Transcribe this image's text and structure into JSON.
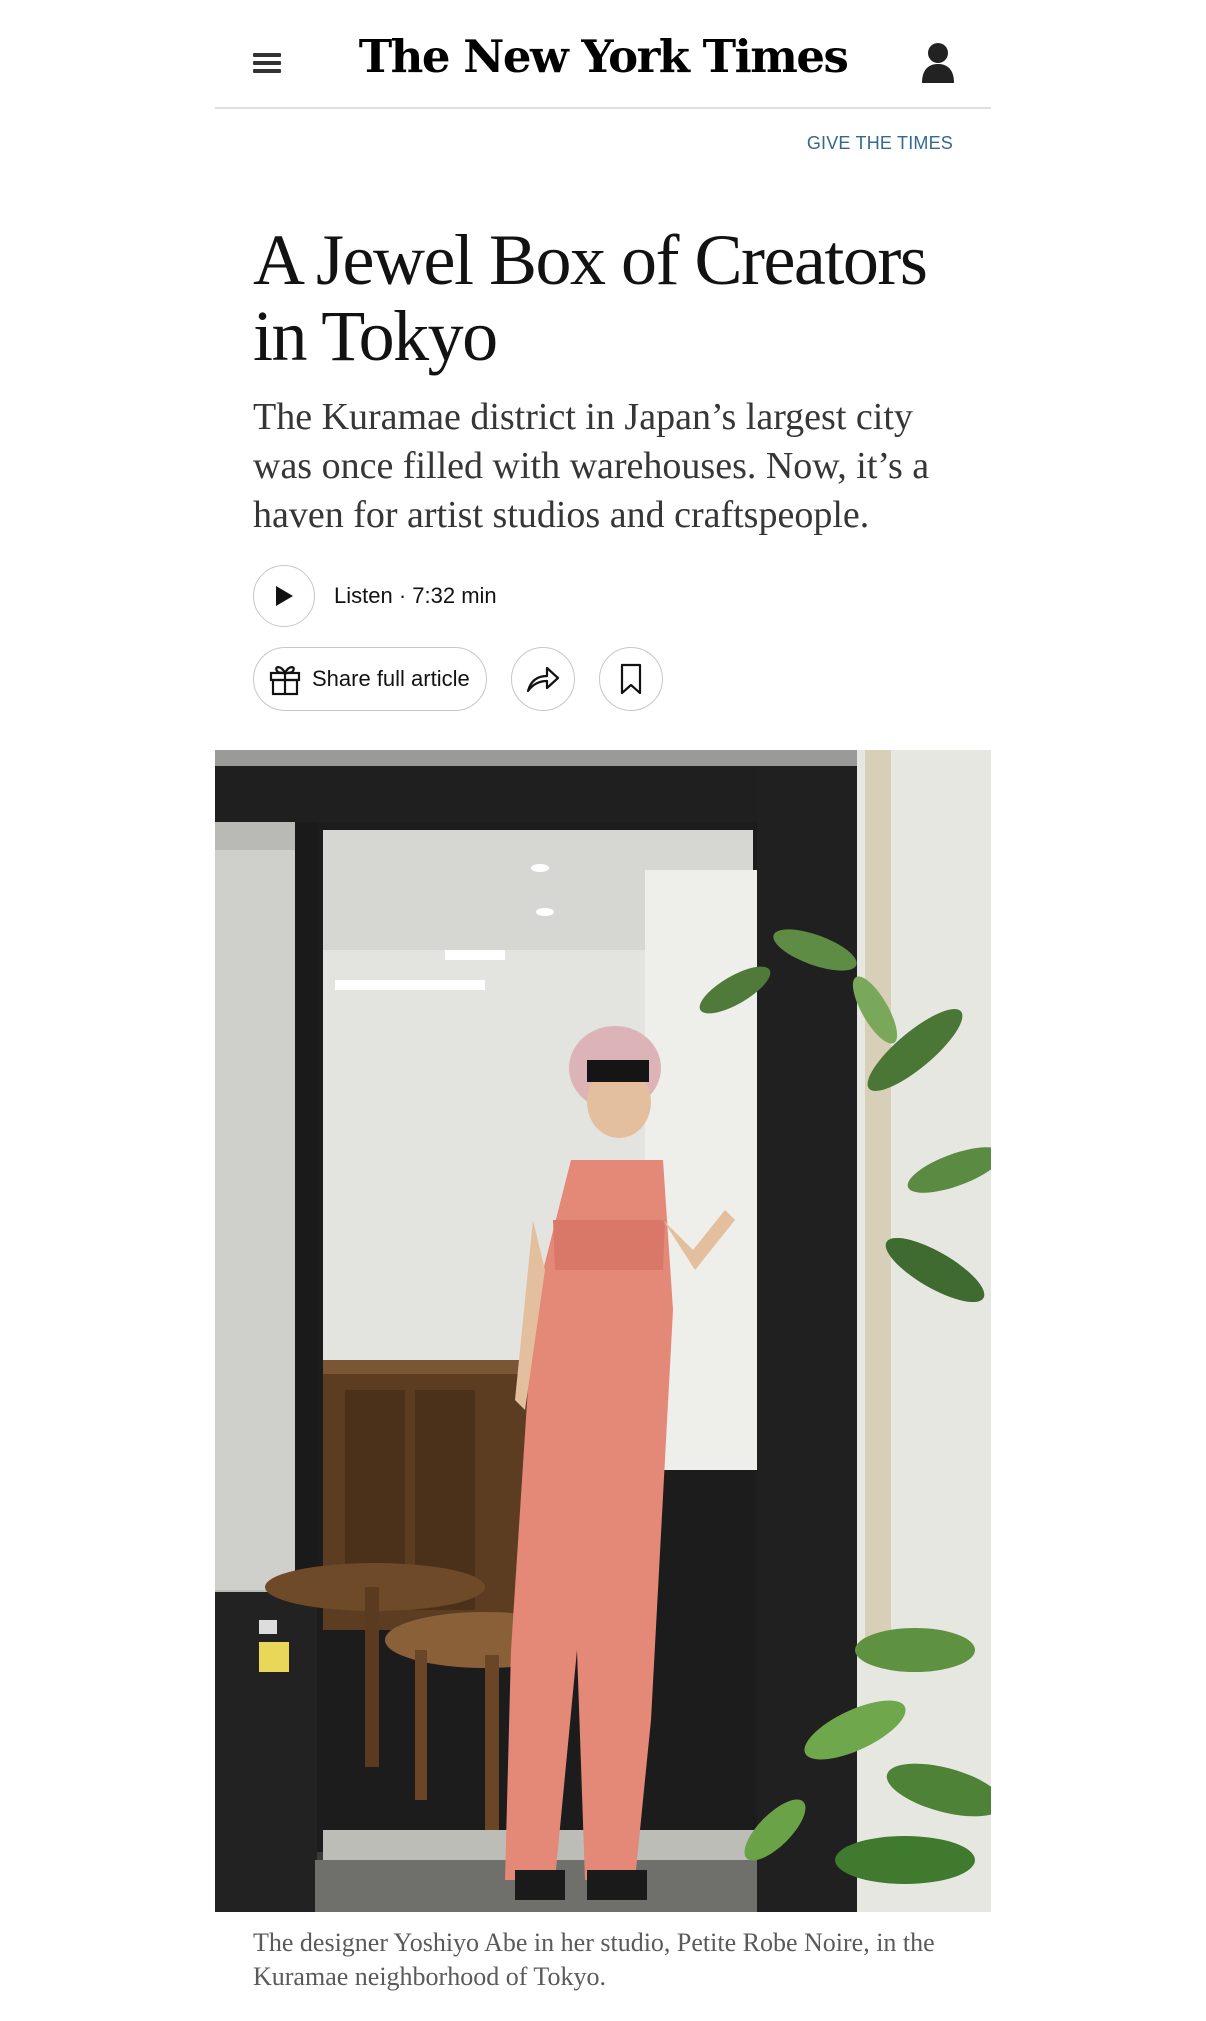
{
  "header": {
    "logo": "The New York Times",
    "menu_icon": "hamburger-menu-icon",
    "account_icon": "user-account-icon"
  },
  "give_link": "GIVE THE TIMES",
  "article": {
    "headline": "A Jewel Box of Creators in Tokyo",
    "summary": "The Kuramae district in Japan’s largest city was once filled with warehouses. Now, it’s a haven for artist studios and craftspeople.",
    "listen": "Listen · 7:32 min",
    "share_label": "Share full article",
    "caption": "The designer Yoshiyo Abe in her studio, Petite Robe Noire, in the Kuramae neighborhood of Tokyo."
  },
  "icons": {
    "play": "play-icon",
    "gift": "gift-icon",
    "share": "share-arrow-icon",
    "bookmark": "bookmark-icon"
  },
  "colors": {
    "link": "#326891",
    "border": "#c7c7c7",
    "text": "#121212",
    "caption": "#5a5a5a"
  }
}
